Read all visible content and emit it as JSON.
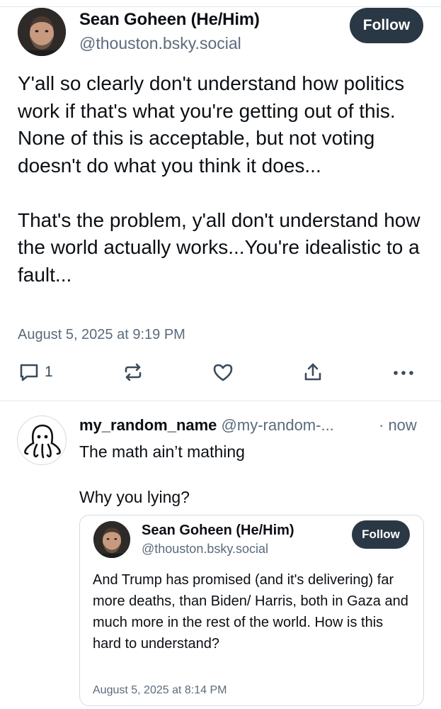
{
  "main_post": {
    "author_name": "Sean Goheen (He/Him)",
    "author_handle": "@thouston.bsky.social",
    "follow_label": "Follow",
    "text": "Y'all so clearly don't understand how politics work if that's what you're getting out of this.\nNone of this is acceptable, but not voting doesn't do what you think it does...\n\nThat's the problem, y'all don't understand how the world actually works...You're idealistic to a fault...",
    "date": "August 5, 2025 at 9:19 PM",
    "reply_count": "1",
    "icons": [
      "reply-icon",
      "repost-icon",
      "like-icon",
      "share-icon",
      "more-icon"
    ]
  },
  "reply": {
    "author_name": "my_random_name",
    "author_handle": "@my-random-...",
    "time": "· now",
    "text": "The math ain’t mathing\n\nWhy you lying?",
    "avatar_icon": "octopus-icon"
  },
  "quoted_post": {
    "author_name": "Sean Goheen (He/Him)",
    "author_handle": "@thouston.bsky.social",
    "follow_label": "Follow",
    "text": "And Trump has promised (and it's delivering) far more deaths, than Biden/ Harris, both in Gaza and much more in the rest of the world. How is this hard to understand?",
    "date": "August 5, 2025 at 8:14 PM"
  },
  "colors": {
    "follow_button_bg": "#2a3744",
    "secondary_text": "#5b6b7c",
    "action_icon": "#3b4b5c"
  }
}
